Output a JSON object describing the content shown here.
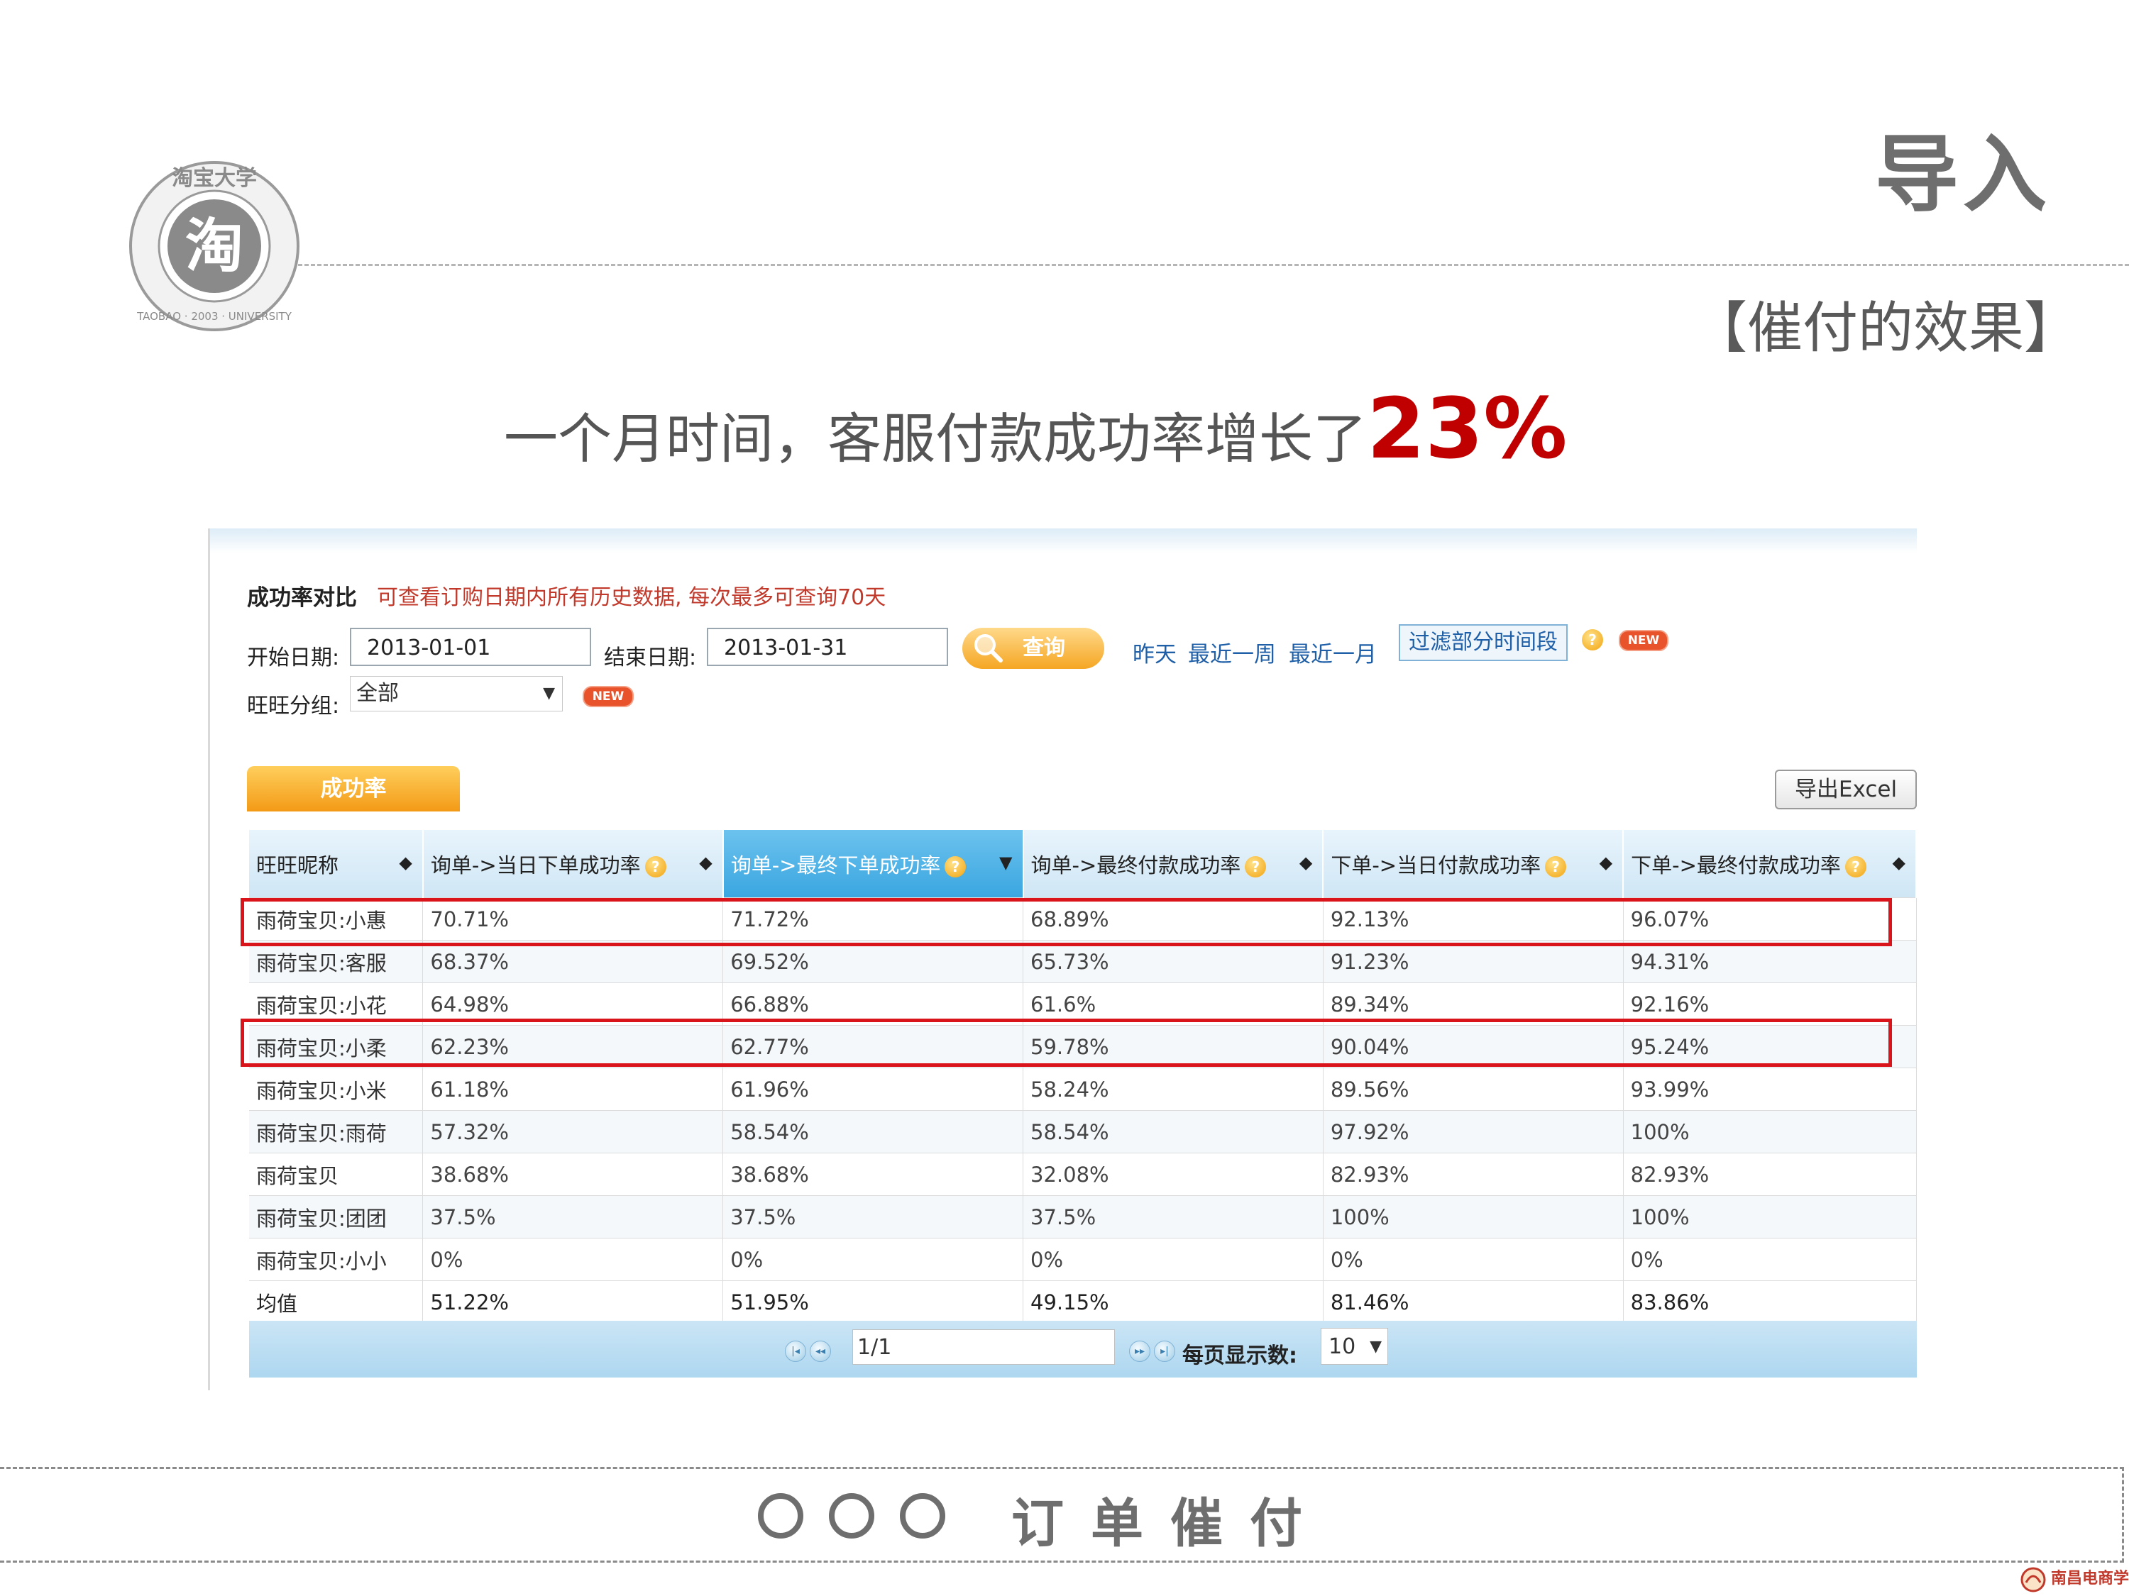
{
  "slide": {
    "section_title": "导入",
    "subtitle": "【催付的效果】",
    "headline_text": "一个月时间，客服付款成功率增长了",
    "headline_highlight": "23%",
    "logo_top_text": "淘宝大学",
    "logo_center": "淘",
    "logo_bottom_text": "TAOBAO · 2003 · UNIVERSITY",
    "footer_circles": "○○○",
    "footer_title": "订单催付",
    "corner_logo_text": "南昌电商学院"
  },
  "panel": {
    "section_label": "成功率对比",
    "section_note": "可查看订购日期内所有历史数据, 每次最多可查询70天",
    "start_label": "开始日期:",
    "start_value": "2013-01-01",
    "end_label": "结束日期:",
    "end_value": "2013-01-31",
    "query_button": "查询",
    "quick_links": [
      "昨天",
      "最近一周",
      "最近一月"
    ],
    "filter_button": "过滤部分时间段",
    "new_badge": "NEW",
    "group_label": "旺旺分组:",
    "group_value": "全部",
    "tab_label": "成功率",
    "export_button": "导出Excel"
  },
  "table": {
    "headers": [
      "旺旺昵称",
      "询单->当日下单成功率",
      "询单->最终下单成功率",
      "询单->最终付款成功率",
      "下单->当日付款成功率",
      "下单->最终付款成功率"
    ],
    "sorted_column": 2,
    "rows": [
      [
        "雨荷宝贝:小惠",
        "70.71%",
        "71.72%",
        "68.89%",
        "92.13%",
        "96.07%"
      ],
      [
        "雨荷宝贝:客服",
        "68.37%",
        "69.52%",
        "65.73%",
        "91.23%",
        "94.31%"
      ],
      [
        "雨荷宝贝:小花",
        "64.98%",
        "66.88%",
        "61.6%",
        "89.34%",
        "92.16%"
      ],
      [
        "雨荷宝贝:小柔",
        "62.23%",
        "62.77%",
        "59.78%",
        "90.04%",
        "95.24%"
      ],
      [
        "雨荷宝贝:小米",
        "61.18%",
        "61.96%",
        "58.24%",
        "89.56%",
        "93.99%"
      ],
      [
        "雨荷宝贝:雨荷",
        "57.32%",
        "58.54%",
        "58.54%",
        "97.92%",
        "100%"
      ],
      [
        "雨荷宝贝",
        "38.68%",
        "38.68%",
        "32.08%",
        "82.93%",
        "82.93%"
      ],
      [
        "雨荷宝贝:团团",
        "37.5%",
        "37.5%",
        "37.5%",
        "100%",
        "100%"
      ],
      [
        "雨荷宝贝:小小",
        "0%",
        "0%",
        "0%",
        "0%",
        "0%"
      ]
    ],
    "average_row": [
      "均值",
      "51.22%",
      "51.95%",
      "49.15%",
      "81.46%",
      "83.86%"
    ],
    "highlighted_rows": [
      0,
      3
    ]
  },
  "pager": {
    "page_value": "1/1",
    "per_page_label": "每页显示数:",
    "per_page_value": "10"
  },
  "colors": {
    "accent_red": "#c00000",
    "highlight_box": "#d9141b",
    "tab_orange": "#f39a16",
    "link_blue": "#1e5fa8"
  }
}
